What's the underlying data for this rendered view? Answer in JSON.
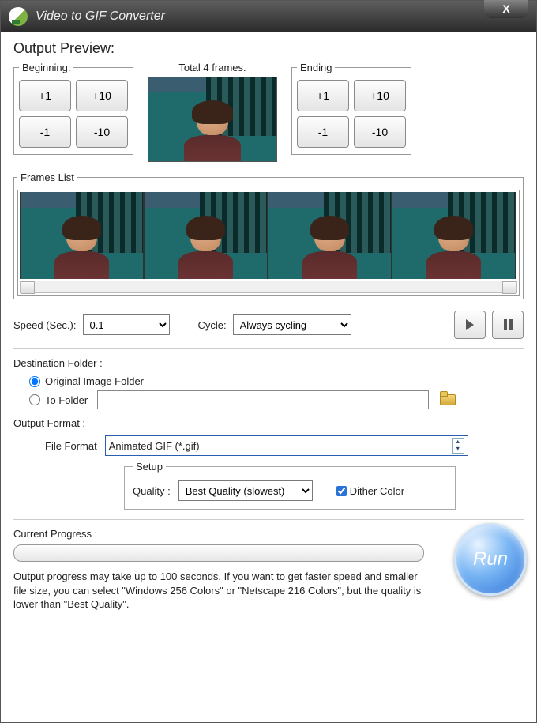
{
  "titlebar": {
    "title": "Video to GIF Converter",
    "close": "X"
  },
  "preview": {
    "heading": "Output Preview:",
    "beginning_legend": "Beginning:",
    "ending_legend": "Ending",
    "btn_plus1": "+1",
    "btn_plus10": "+10",
    "btn_minus1": "-1",
    "btn_minus10": "-10",
    "total_frames": "Total 4 frames."
  },
  "frames": {
    "legend": "Frames List"
  },
  "controls": {
    "speed_label": "Speed (Sec.):",
    "speed_value": "0.1",
    "cycle_label": "Cycle:",
    "cycle_value": "Always cycling"
  },
  "destination": {
    "heading": "Destination Folder :",
    "opt_original": "Original Image Folder",
    "opt_tofolder": "To Folder",
    "folder_value": ""
  },
  "format": {
    "heading": "Output Format :",
    "file_format_label": "File Format",
    "file_format_value": "Animated GIF (*.gif)",
    "setup_legend": "Setup",
    "quality_label": "Quality :",
    "quality_value": "Best Quality (slowest)",
    "dither_label": "Dither Color",
    "dither_checked": true
  },
  "progress": {
    "label": "Current Progress :",
    "hint": "Output progress may take up to 100 seconds. If you want to get faster speed and smaller file size, you can select \"Windows 256 Colors\" or \"Netscape 216 Colors\", but the quality is lower than \"Best Quality\"."
  },
  "run": {
    "label": "Run"
  }
}
